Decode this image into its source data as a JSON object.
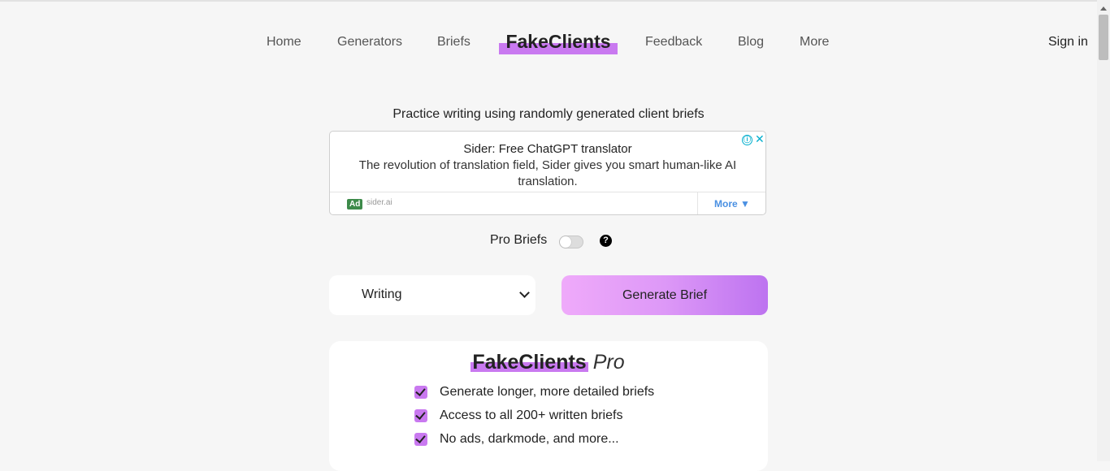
{
  "nav": {
    "home": "Home",
    "generators": "Generators",
    "briefs": "Briefs",
    "brand": "FakeClients",
    "feedback": "Feedback",
    "blog": "Blog",
    "more": "More",
    "sign_in": "Sign in"
  },
  "tagline": "Practice writing using randomly generated client briefs",
  "ad": {
    "title": "Sider: Free ChatGPT translator",
    "text": "The revolution of translation field, Sider gives you smart human-like AI translation.",
    "badge": "Ad",
    "domain": "sider.ai",
    "more": "More ▼",
    "info_icon": "ⓘ",
    "close_icon": "✕"
  },
  "pro_toggle": {
    "label": "Pro Briefs",
    "enabled": false,
    "help": "?"
  },
  "category_select": {
    "value": "Writing"
  },
  "generate_button": {
    "label": "Generate Brief"
  },
  "pro_card": {
    "brand": "FakeClients",
    "pro": "Pro",
    "features": [
      "Generate longer, more detailed briefs",
      "Access to all 200+ written briefs",
      "No ads, darkmode, and more..."
    ]
  },
  "colors": {
    "accent": "#c979f0",
    "background": "#f6f6f6",
    "gradient_start": "#efaafa",
    "gradient_end": "#bd73f0",
    "ad_link": "#00aecd"
  }
}
